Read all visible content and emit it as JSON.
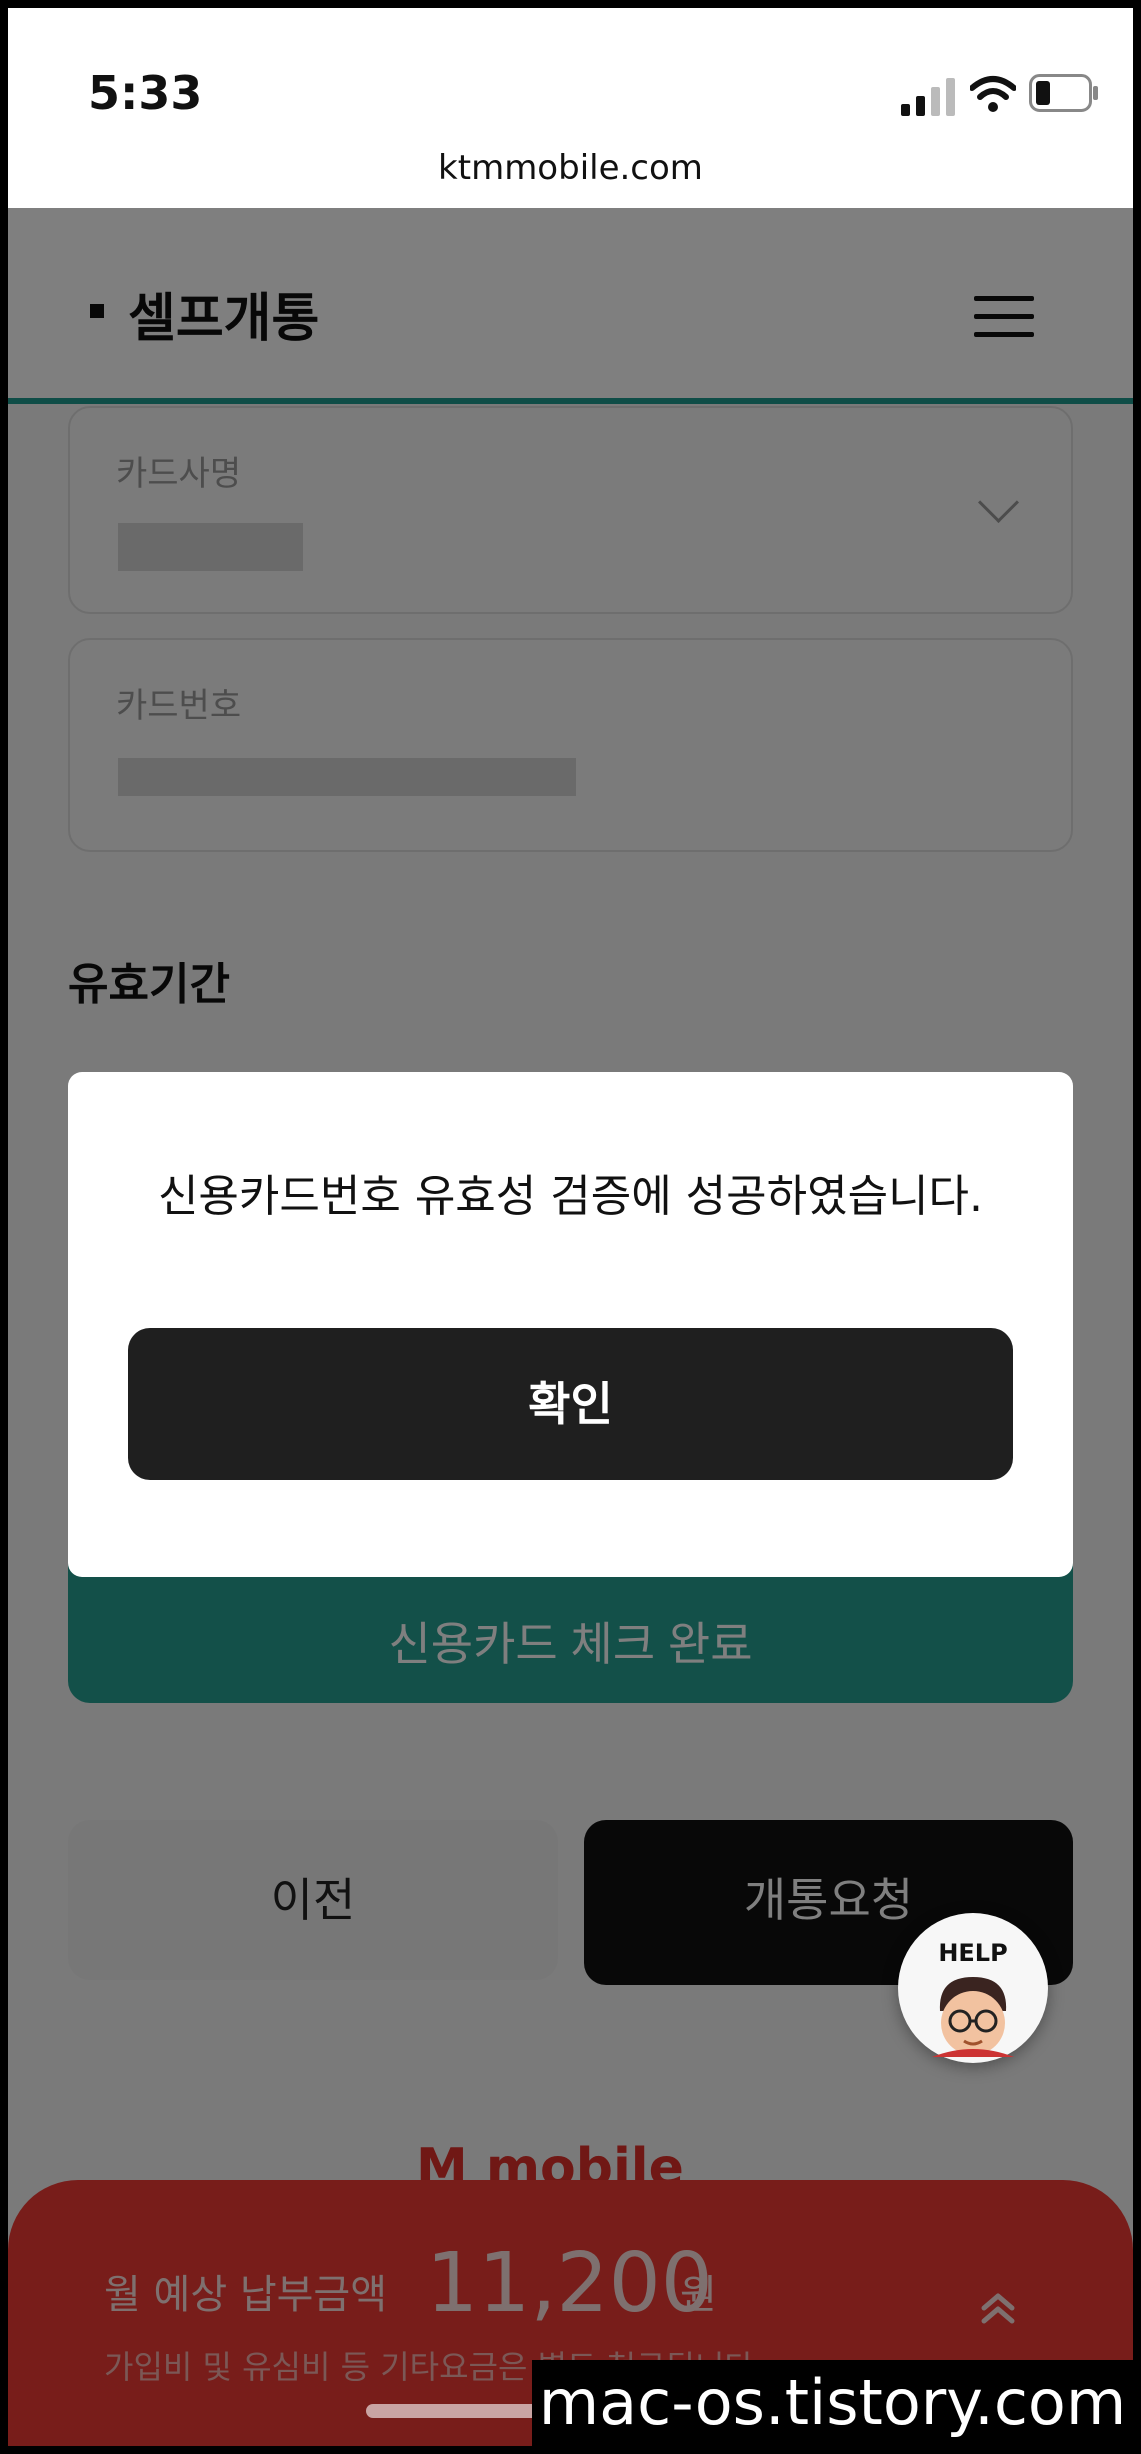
{
  "status_bar": {
    "time": "5:33",
    "url": "ktmmobile.com"
  },
  "header": {
    "title": "셀프개통"
  },
  "form": {
    "card_company_label": "카드사명",
    "card_number_label": "카드번호",
    "expiry_section_title": "유효기간",
    "check_button_label": "신용카드 체크 완료"
  },
  "nav": {
    "prev_label": "이전",
    "request_label": "개통요청"
  },
  "help": {
    "label": "HELP"
  },
  "footer": {
    "logo_text": "M mobile"
  },
  "fee": {
    "label": "월 예상 납부금액",
    "amount": "11,200",
    "unit": "원",
    "note": "가입비 및 유심비 등 기타요금은 별도 청구됩니다"
  },
  "dialog": {
    "message": "신용카드번호 유효성 검증에 성공하였습니다.",
    "confirm_label": "확인"
  },
  "watermark": "mac-os.tistory.com",
  "colors": {
    "accent": "#1f9a8e",
    "brand_red": "#f13b34",
    "dark": "#1f1f1f"
  }
}
